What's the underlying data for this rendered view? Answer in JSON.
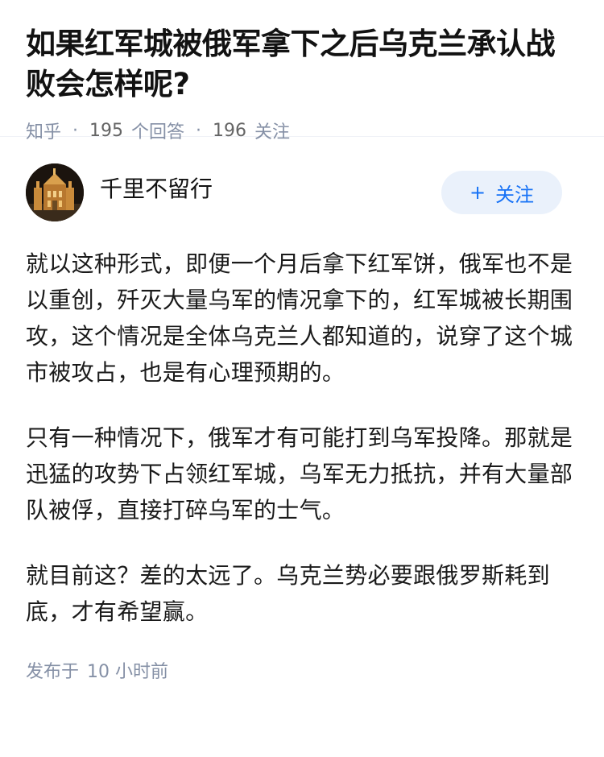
{
  "question": {
    "title": "如果红军城被俄军拿下之后乌克兰承认战败会怎样呢?"
  },
  "meta": {
    "source": "知乎",
    "answers_count": "195",
    "answers_label": "个回答",
    "followers_count": "196",
    "followers_label": "关注",
    "separator": "·"
  },
  "author": {
    "name": "千里不留行",
    "follow_label": "关注",
    "follow_icon": "plus-icon"
  },
  "content": {
    "paragraphs": [
      "就以这种形式，即便一个月后拿下红军饼，俄军也不是以重创，歼灭大量乌军的情况拿下的，红军城被长期围攻，这个情况是全体乌克兰人都知道的，说穿了这个城市被攻占，也是有心理预期的。",
      "只有一种情况下，俄军才有可能打到乌军投降。那就是迅猛的攻势下占领红军城，乌军无力抵抗，并有大量部队被俘，直接打碎乌军的士气。",
      "就目前这？差的太远了。乌克兰势必要跟俄罗斯耗到底，才有希望赢。"
    ]
  },
  "publish": {
    "label": "发布于",
    "value": "10 小时前"
  },
  "colors": {
    "accent": "#1772f6",
    "meta_gray": "#8590a6",
    "follow_bg": "#eaf1fb"
  }
}
